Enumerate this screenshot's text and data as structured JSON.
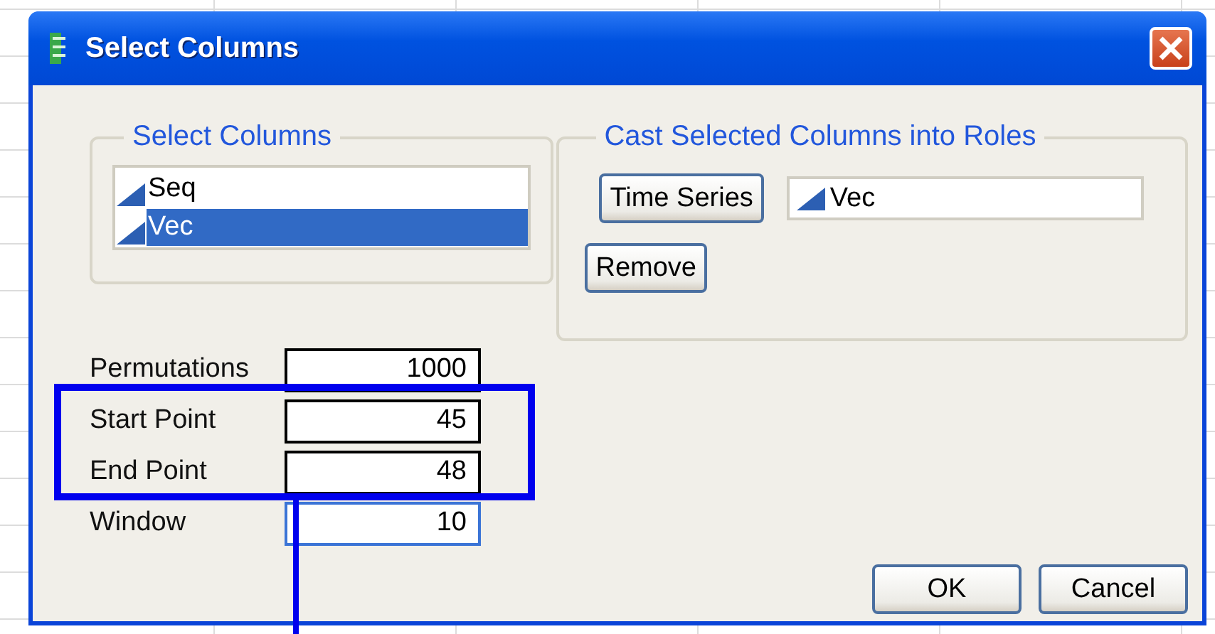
{
  "window": {
    "title": "Select Columns"
  },
  "select_columns": {
    "title": "Select Columns",
    "items": [
      {
        "name": "Seq",
        "selected": false
      },
      {
        "name": "Vec",
        "selected": true
      }
    ]
  },
  "cast_roles": {
    "title": "Cast Selected Columns into Roles",
    "roles": [
      {
        "button": "Time Series",
        "columns": [
          "Vec"
        ]
      }
    ],
    "remove_button": "Remove"
  },
  "fields": [
    {
      "label": "Permutations",
      "value": "1000",
      "focused": false
    },
    {
      "label": "Start Point",
      "value": "45",
      "focused": false
    },
    {
      "label": "End Point",
      "value": "48",
      "focused": false
    },
    {
      "label": "Window",
      "value": "10",
      "focused": true
    }
  ],
  "buttons": [
    "OK",
    "Cancel"
  ],
  "annotations": {
    "highlight_box": true,
    "pointer_line": true
  }
}
